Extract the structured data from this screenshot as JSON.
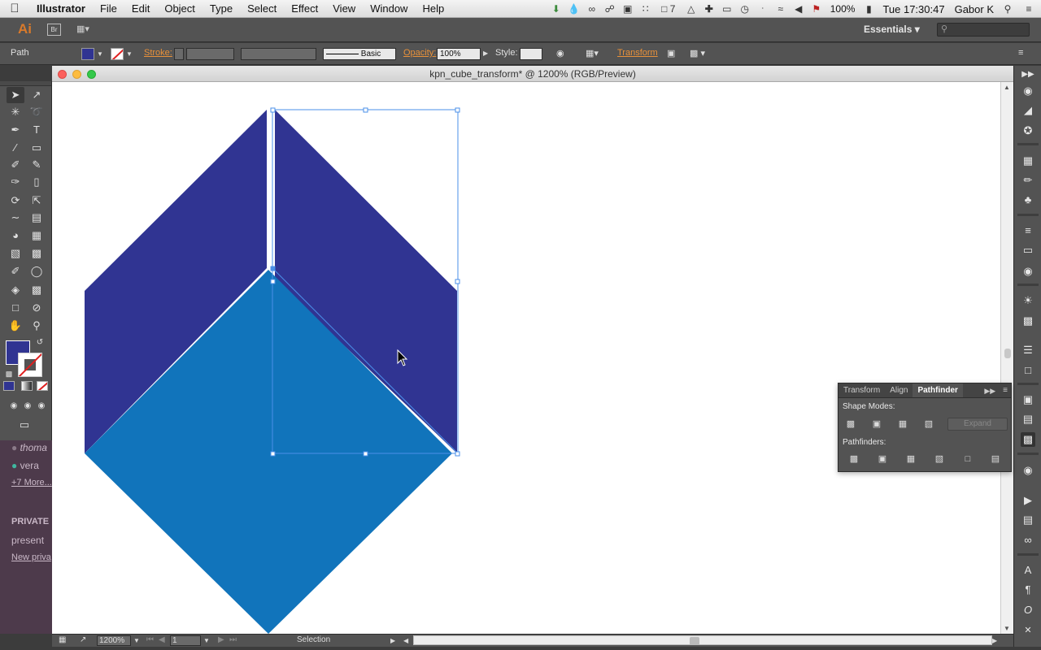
{
  "menubar": {
    "app_name": "Illustrator",
    "menus": [
      "File",
      "Edit",
      "Object",
      "Type",
      "Select",
      "Effect",
      "View",
      "Window",
      "Help"
    ],
    "battery": "100%",
    "clock": "Tue 17:30:47",
    "user": "Gabor K",
    "notif_count": "7"
  },
  "appbar": {
    "logo": "Ai",
    "bridge": "Br",
    "workspace": "Essentials"
  },
  "control": {
    "selection_type": "Path",
    "stroke_label": "Stroke:",
    "brush_label": "Basic",
    "opacity_label": "Opacity:",
    "opacity_value": "100%",
    "style_label": "Style:",
    "transform_label": "Transform"
  },
  "document": {
    "title": "kpn_cube_transform* @ 1200% (RGB/Preview)"
  },
  "status": {
    "zoom": "1200%",
    "artboard": "1",
    "tool_name": "Selection"
  },
  "colors": {
    "cube_dark": "#303492",
    "cube_light": "#1174bb",
    "selection": "#4a8fe8",
    "fill_swatch": "#303492"
  },
  "pathfinder_panel": {
    "tabs": [
      "Transform",
      "Align",
      "Pathfinder"
    ],
    "shape_modes_label": "Shape Modes:",
    "pathfinders_label": "Pathfinders:",
    "expand_label": "Expand"
  },
  "bgapp": {
    "user1": "thoma",
    "user2": "vera",
    "more": "+7 More...",
    "private_header": "PRIVATE",
    "present": "present",
    "new_private": "New priva"
  }
}
